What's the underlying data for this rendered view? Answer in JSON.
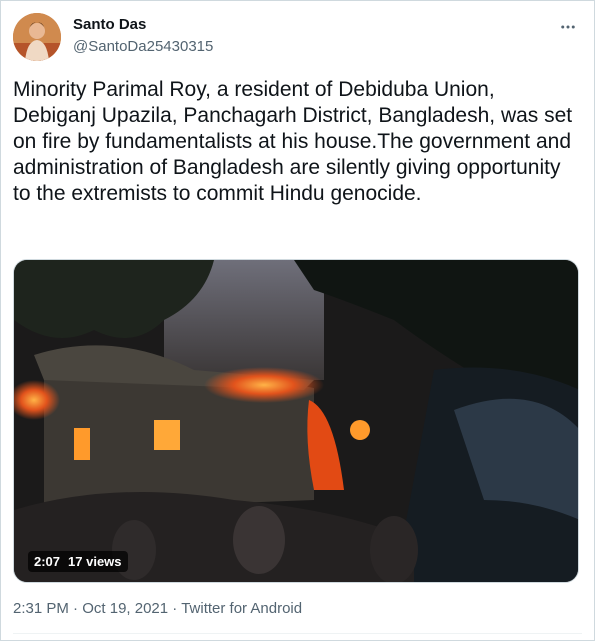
{
  "author": {
    "display_name": "Santo Das",
    "handle": "@SantoDa25430315"
  },
  "tweet": {
    "text": "Minority Parimal Roy, a resident of Debiduba Union, Debiganj Upazila, Panchagarh District, Bangladesh, was set on fire by fundamentalists at his house.The government and administration of Bangladesh are silently giving opportunity to the extremists to commit Hindu genocide."
  },
  "media": {
    "duration": "2:07",
    "views": "17 views"
  },
  "footer": {
    "time": "2:31 PM",
    "date": "Oct 19, 2021",
    "source": "Twitter for Android",
    "separator": "·"
  },
  "icons": {
    "more": "more-horizontal-icon"
  }
}
